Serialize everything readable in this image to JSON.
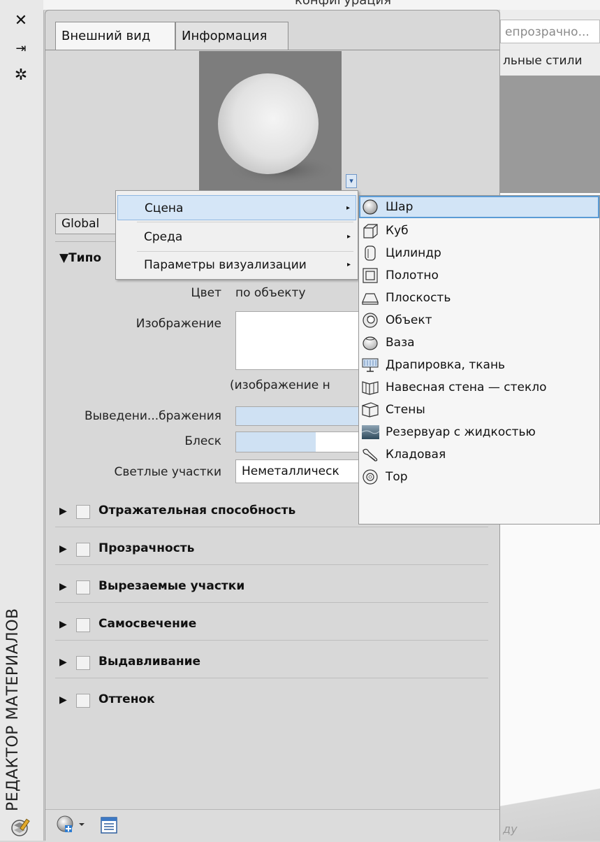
{
  "strip": {
    "title": "РЕДАКТОР МАТЕРИАЛОВ",
    "close_glyph": "✕",
    "pin_glyph": "⇥",
    "gear_glyph": "✲"
  },
  "background": {
    "top_text": "конфигурация",
    "transparency_label": "епрозрачно...",
    "styles_label": "льные стили",
    "viewport_text": "ду"
  },
  "tabs": [
    {
      "label": "Внешний вид"
    },
    {
      "label": "Информация"
    }
  ],
  "preview": {
    "dropdown_glyph": "▾"
  },
  "global_button": "Global",
  "generic_section": {
    "title": "▼Типо",
    "color_label": "Цвет",
    "color_value": "по объекту",
    "image_label": "Изображение",
    "image_note": "(изображение н",
    "fade_label": "Выведени...бражения",
    "gloss_label": "Блеск",
    "gloss_level": 0.64,
    "highlights_label": "Светлые участки",
    "highlights_value": "Неметаллическ"
  },
  "sections": [
    {
      "label": "Отражательная способность"
    },
    {
      "label": "Прозрачность"
    },
    {
      "label": "Вырезаемые участки"
    },
    {
      "label": "Самосвечение"
    },
    {
      "label": "Выдавливание"
    },
    {
      "label": "Оттенок"
    }
  ],
  "context_menu": {
    "items": [
      {
        "label": "Сцена",
        "has_submenu": true,
        "selected": true
      },
      {
        "label": "Среда",
        "has_submenu": true,
        "selected": false
      },
      {
        "label": "Параметры визуализации",
        "has_submenu": true,
        "selected": false
      }
    ],
    "arrow_glyph": "▸"
  },
  "submenu": {
    "items": [
      {
        "label": "Шар",
        "icon": "sphere-icon",
        "selected": true
      },
      {
        "label": "Куб",
        "icon": "cube-icon"
      },
      {
        "label": "Цилиндр",
        "icon": "cylinder-icon"
      },
      {
        "label": "Полотно",
        "icon": "canvas-icon"
      },
      {
        "label": "Плоскость",
        "icon": "plane-icon"
      },
      {
        "label": "Объект",
        "icon": "object-icon"
      },
      {
        "label": "Ваза",
        "icon": "vase-icon"
      },
      {
        "label": "Драпировка, ткань",
        "icon": "drapery-icon"
      },
      {
        "label": "Навесная стена — стекло",
        "icon": "curtain-wall-icon"
      },
      {
        "label": "Стены",
        "icon": "walls-icon"
      },
      {
        "label": "Резервуар с жидкостью",
        "icon": "liquid-pool-icon"
      },
      {
        "label": "Кладовая",
        "icon": "utility-icon"
      },
      {
        "label": "Тор",
        "icon": "torus-icon"
      }
    ]
  },
  "colors": {
    "selection_fill": "#d2e4f6",
    "selection_border": "#5b9bd5",
    "panel_bg": "#d8d8d8"
  }
}
